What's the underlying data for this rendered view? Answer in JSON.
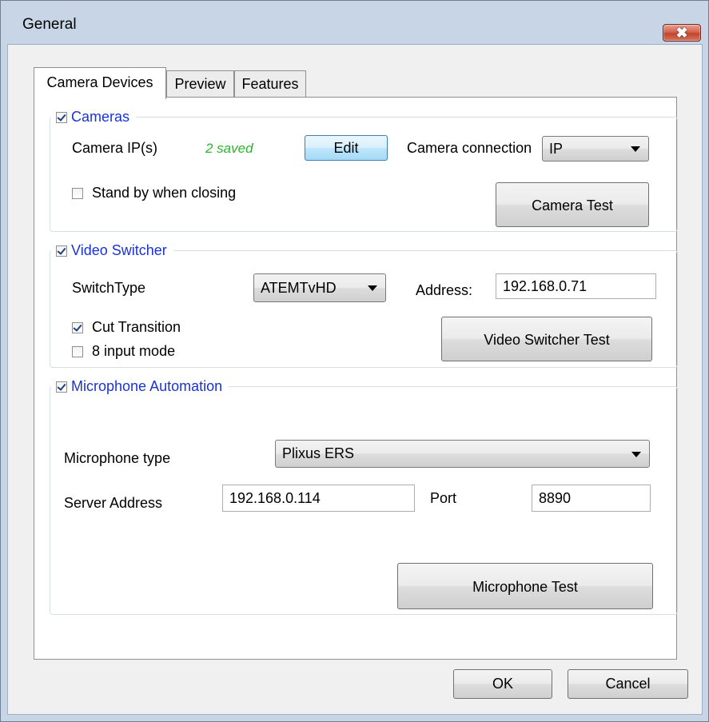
{
  "window": {
    "title": "General",
    "close_symbol": "✖"
  },
  "tabs": [
    {
      "label": "Camera Devices",
      "active": true
    },
    {
      "label": "Preview",
      "active": false
    },
    {
      "label": "Features",
      "active": false
    }
  ],
  "cameras": {
    "group_label": "Cameras",
    "enabled": true,
    "ip_label": "Camera IP(s)",
    "ip_status": "2 saved",
    "edit_label": "Edit",
    "connection_label": "Camera connection",
    "connection_value": "IP",
    "standby_label": "Stand by when closing",
    "standby_checked": false,
    "test_label": "Camera Test"
  },
  "video_switcher": {
    "group_label": "Video Switcher",
    "enabled": true,
    "switch_type_label": "SwitchType",
    "switch_type_value": "ATEMTvHD",
    "address_label": "Address:",
    "address_value": "192.168.0.71",
    "cut_transition_label": "Cut Transition",
    "cut_transition_checked": true,
    "input_mode_label": "8 input mode",
    "input_mode_checked": false,
    "test_label": "Video Switcher Test"
  },
  "microphone": {
    "group_label": "Microphone Automation",
    "enabled": true,
    "type_label": "Microphone type",
    "type_value": "Plixus ERS",
    "server_label": "Server Address",
    "server_value": "192.168.0.114",
    "port_label": "Port",
    "port_value": "8890",
    "test_label": "Microphone Test"
  },
  "footer": {
    "ok_label": "OK",
    "cancel_label": "Cancel"
  },
  "colors": {
    "group_label": "#1a33d6",
    "saved_status": "#2bb52b",
    "close_button": "#c2432d"
  }
}
